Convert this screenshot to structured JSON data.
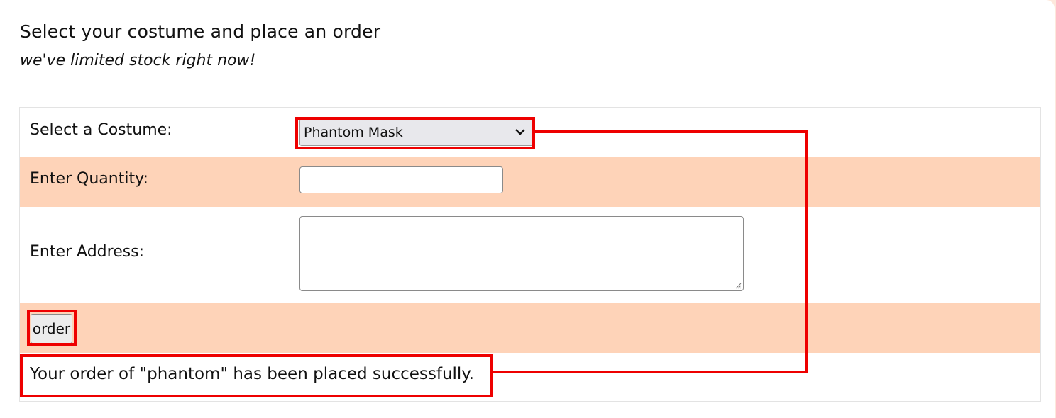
{
  "header": {
    "title": "Select your costume and place an order",
    "subtitle": "we've limited stock right now!"
  },
  "form": {
    "costume_label": "Select a Costume:",
    "costume_selected": "Phantom Mask",
    "quantity_label": "Enter Quantity:",
    "quantity_value": "",
    "address_label": "Enter Address:",
    "address_value": "",
    "order_button": "order",
    "success_message": "Your order of \"phantom\" has been placed successfully."
  },
  "colors": {
    "row_accent": "#fed3b8",
    "highlight": "#ee0000",
    "page_bg": "#ffffff",
    "outer_bg": "#fde8dc"
  },
  "icons": {
    "select_arrow": "chevron-down-icon",
    "textarea_grip": "resize-grip-icon"
  }
}
